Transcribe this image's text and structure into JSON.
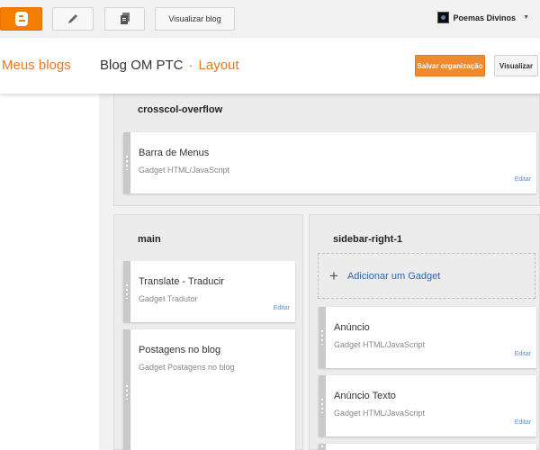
{
  "toolbar": {
    "blogger_icon": "blogger-logo-icon",
    "pencil_icon": "pencil-icon",
    "pages_icon": "pages-icon",
    "view_blog_label": "Visualizar blog",
    "account_name": "Poemas Divinos",
    "brand_color": "#f57d00"
  },
  "header": {
    "my_blogs_label": "Meus blogs",
    "blog_name": "Blog OM PTC",
    "separator": "·",
    "current_page": "Layout",
    "save_label": "Salvar organização",
    "preview_label": "Visualizar"
  },
  "sections": {
    "crosscol": {
      "title": "crosscol-overflow",
      "gadgets": [
        {
          "title": "Barra de Menus",
          "type": "Gadget HTML/JavaScript",
          "edit": "Editar"
        }
      ]
    },
    "main": {
      "title": "main",
      "gadgets": [
        {
          "title": "Translate - Traducir",
          "type": "Gadget Tradutor",
          "edit": "Editar"
        },
        {
          "title": "Postagens no blog",
          "type": "Gadget Postagens no blog"
        }
      ]
    },
    "sidebar": {
      "title": "sidebar-right-1",
      "add_gadget_label": "Adicionar um Gadget",
      "add_symbol": "+",
      "gadgets": [
        {
          "title": "Anúncio",
          "type": "Gadget HTML/JavaScript",
          "edit": "Editar"
        },
        {
          "title": "Anúncio Texto",
          "type": "Gadget HTML/JavaScript",
          "edit": "Editar"
        }
      ]
    }
  }
}
